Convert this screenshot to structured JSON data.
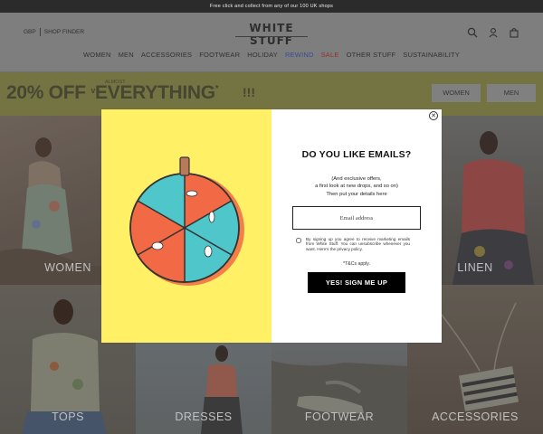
{
  "promo_bar": {
    "text": "Free click and collect from any of our 100 UK shops"
  },
  "header": {
    "currency": "GBP",
    "shop_finder": "SHOP FINDER",
    "logo": "WHITE STUFF",
    "icons": [
      "search-icon",
      "account-icon",
      "bag-icon"
    ]
  },
  "nav": {
    "items": [
      {
        "label": "WOMEN"
      },
      {
        "label": "MEN"
      },
      {
        "label": "ACCESSORIES"
      },
      {
        "label": "FOOTWEAR"
      },
      {
        "label": "HOLIDAY"
      },
      {
        "label": "REWIND",
        "color": "#3b4fa8"
      },
      {
        "label": "SALE",
        "color": "#a33030"
      },
      {
        "label": "OTHER STUFF"
      },
      {
        "label": "SUSTAINABILITY"
      }
    ]
  },
  "banner": {
    "headline_part1": "20% OFF",
    "almost": "ALMOST",
    "caret": "v",
    "headline_part2": "EVERYTHING",
    "asterisk": "*",
    "exclaim": "!!!",
    "women_button": "WOMEN",
    "men_button": "MEN",
    "background": "#7f7f46"
  },
  "categories": {
    "women": "WOMEN",
    "linen": "LINEN",
    "tops": "TOPS",
    "dresses": "DRESSES",
    "footwear": "FOOTWEAR",
    "accessories": "ACCESSORIES"
  },
  "modal": {
    "heading": "DO YOU LIKE EMAILS?",
    "sub_line1": "(And exclusive offers,",
    "sub_line2": "a first look at new drops, and so on)",
    "sub_line3": "Then put your details here",
    "email_placeholder": "Email address",
    "consent_text": "By signing up you agree to receive marketing emails from White Stuff. You can unsubscribe whenever you want. Here's the privacy policy.",
    "tcs": "*T&Cs apply.",
    "signup_button": "YES! SIGN ME UP",
    "close_icon": "close-icon",
    "left_background": "#fff066",
    "wheel_colors": [
      "#4fc6c9",
      "#f26a45"
    ]
  }
}
